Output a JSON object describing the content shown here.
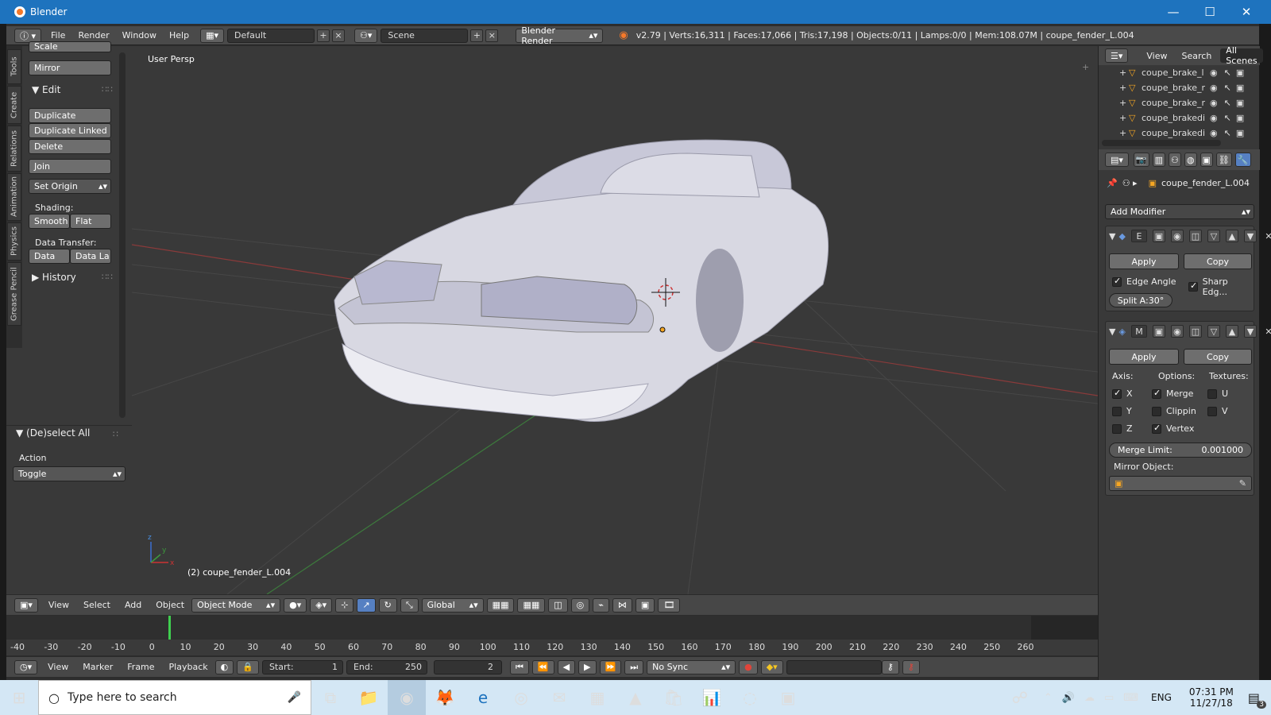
{
  "window": {
    "title": "Blender",
    "minimize": "—",
    "maximize": "☐",
    "close": "✕"
  },
  "infobar": {
    "menus": [
      "File",
      "Render",
      "Window",
      "Help"
    ],
    "screen_layout": "Default",
    "scene": "Scene",
    "render_engine": "Blender Render",
    "stats": "v2.79 | Verts:16,311 | Faces:17,066 | Tris:17,198 | Objects:0/11 | Lamps:0/0 | Mem:108.07M | coupe_fender_L.004"
  },
  "tool_tabs": [
    "Tools",
    "Create",
    "Relations",
    "Animation",
    "Physics",
    "Grease Pencil"
  ],
  "tools": {
    "scale": "Scale",
    "mirror": "Mirror",
    "edit_header": "Edit",
    "duplicate": "Duplicate",
    "duplicate_linked": "Duplicate Linked",
    "delete": "Delete",
    "join": "Join",
    "set_origin": "Set Origin",
    "shading_label": "Shading:",
    "smooth": "Smooth",
    "flat": "Flat",
    "data_transfer_label": "Data Transfer:",
    "data": "Data",
    "data_layout": "Data La",
    "history_header": "History"
  },
  "operator_panel": {
    "title": "(De)select All",
    "action_label": "Action",
    "action_value": "Toggle"
  },
  "viewport": {
    "view_label": "User Persp",
    "object_label": "(2) coupe_fender_L.004",
    "axis_x": "x",
    "axis_y": "y",
    "axis_z": "z"
  },
  "viewport_header": {
    "menus": [
      "View",
      "Select",
      "Add",
      "Object"
    ],
    "mode": "Object Mode",
    "orientation": "Global"
  },
  "timeline": {
    "ticks": [
      "-40",
      "-30",
      "-20",
      "-10",
      "0",
      "10",
      "20",
      "30",
      "40",
      "50",
      "60",
      "70",
      "80",
      "90",
      "100",
      "110",
      "120",
      "130",
      "140",
      "150",
      "160",
      "170",
      "180",
      "190",
      "200",
      "210",
      "220",
      "230",
      "240",
      "250",
      "260"
    ],
    "menus": [
      "View",
      "Marker",
      "Frame",
      "Playback"
    ],
    "start_label": "Start:",
    "start_value": "1",
    "end_label": "End:",
    "end_value": "250",
    "current_frame": "2",
    "sync": "No Sync"
  },
  "outliner": {
    "menus": [
      "View",
      "Search"
    ],
    "scope": "All Scenes",
    "items": [
      "coupe_brake_l",
      "coupe_brake_r",
      "coupe_brake_r",
      "coupe_brakedi",
      "coupe_brakedi"
    ]
  },
  "properties": {
    "object_name": "coupe_fender_L.004",
    "add_modifier": "Add Modifier",
    "edge_split": {
      "short": "E",
      "apply": "Apply",
      "copy": "Copy",
      "edge_angle": "Edge Angle",
      "sharp_edges": "Sharp Edg...",
      "split_angle": "Split A:30°"
    },
    "mirror": {
      "short": "M",
      "apply": "Apply",
      "copy": "Copy",
      "axis_label": "Axis:",
      "options_label": "Options:",
      "textures_label": "Textures:",
      "x": "X",
      "y": "Y",
      "z": "Z",
      "merge": "Merge",
      "clipping": "Clippin",
      "vertex": "Vertex",
      "u": "U",
      "v": "V",
      "merge_limit_label": "Merge Limit:",
      "merge_limit_value": "0.001000",
      "mirror_object_label": "Mirror Object:"
    }
  },
  "taskbar": {
    "search_placeholder": "Type here to search",
    "language": "ENG",
    "time": "07:31 PM",
    "date": "11/27/18",
    "notifications": "3"
  },
  "colors": {
    "title_bar": "#1e73be",
    "viewport_bg": "#393939",
    "header": "#474747",
    "taskbar": "#d4e7f5"
  }
}
